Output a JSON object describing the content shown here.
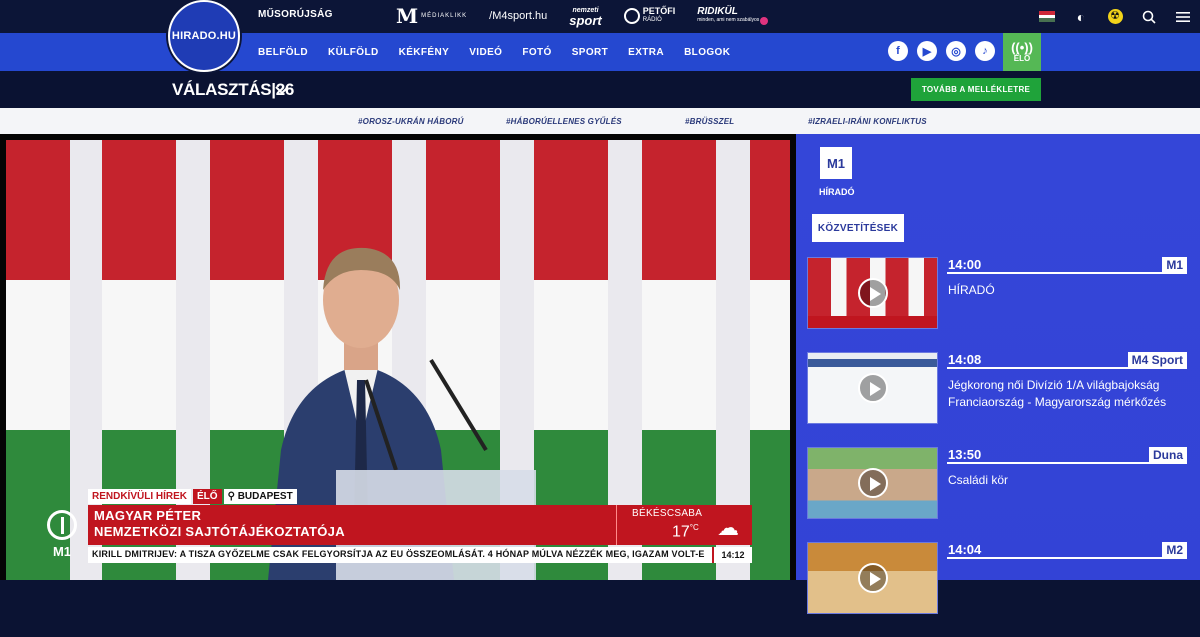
{
  "site": {
    "logo_text": "HIRADO.HU",
    "musorujsag": "MŰSORÚJSÁG"
  },
  "partners": {
    "mediaklikk_m": "M",
    "mediaklikk_text": "MÉDIAKLIKK",
    "m4sport": "/M4sport.hu",
    "nemzeti_sport_top": "nemzeti",
    "nemzeti_sport_bottom": "sport",
    "petofi_top": "PETŐFI",
    "petofi_bottom": "RÁDIÓ",
    "ridikul_top": "RIDIKÜL",
    "ridikul_bottom": "minden, ami nem szabályos"
  },
  "nav": {
    "items": [
      "BELFÖLD",
      "KÜLFÖLD",
      "KÉKFÉNY",
      "VIDEÓ",
      "FOTÓ",
      "SPORT",
      "EXTRA",
      "BLOGOK"
    ],
    "social": [
      "f",
      "▶",
      "◎",
      "♪"
    ],
    "elo_label": "ÉLŐ"
  },
  "election": {
    "title": "VÁLASZTÁS|26",
    "button": "TOVÁBB A MELLÉKLETRE"
  },
  "hashtags": [
    "#OROSZ-UKRÁN HÁBORÚ",
    "#HÁBORÚELLENES GYŰLÉS",
    "#BRÜSSZEL",
    "#IZRAELI-IRÁNI KONFLIKTUS"
  ],
  "video": {
    "breaking": "RENDKÍVÜLI HÍREK",
    "live": "ÉLŐ",
    "location": "BUDAPEST",
    "headline_1": "MAGYAR PÉTER",
    "headline_2": "NEMZETKÖZI SAJTÓTÁJÉKOZTATÓJA",
    "weather_city": "BÉKÉSCSABA",
    "weather_temp": "17",
    "weather_unit": "°C",
    "ticker": "KIRILL DMITRIJEV: A TISZA GYŐZELME CSAK FELGYORSÍTJA AZ EU ÖSSZEOMLÁSÁT. 4 HÓNAP MÚLVA NÉZZÉK MEG, IGAZAM VOLT-E",
    "ticker_time": "14:12",
    "channel_bug": "M1"
  },
  "side": {
    "channel_logo": "M1",
    "channel_label": "HÍRADÓ",
    "kozvetitesek": "KÖZVETÍTÉSEK",
    "items": [
      {
        "time": "14:00",
        "channel": "M1",
        "title": "HÍRADÓ"
      },
      {
        "time": "14:08",
        "channel": "M4 Sport",
        "title": "Jégkorong női Divízió 1/A világbajokság Franciaország - Magyarország mérkőzés"
      },
      {
        "time": "13:50",
        "channel": "Duna",
        "title": "Családi kör"
      },
      {
        "time": "14:04",
        "channel": "M2",
        "title": ""
      }
    ]
  },
  "colors": {
    "primary_blue": "#2548d0",
    "dark_navy": "#0c1537",
    "news_red": "#c0151f",
    "live_green": "#55b855",
    "button_green": "#1fa33a",
    "side_blue": "#3446d8"
  },
  "icons": [
    "moon-theme-icon",
    "radiation-icon",
    "search-icon",
    "menu-icon",
    "hungarian-flag-icon",
    "chevron-down-icon",
    "location-pin-icon",
    "cloud-icon",
    "play-icon",
    "broadcast-icon"
  ]
}
